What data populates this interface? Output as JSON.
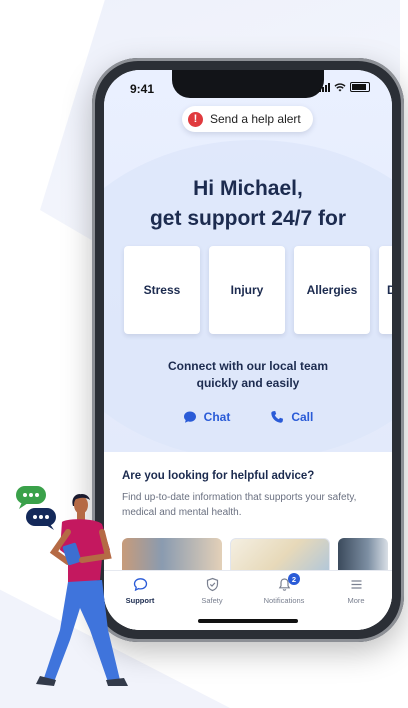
{
  "status_bar": {
    "time": "9:41"
  },
  "help_alert": {
    "icon": "exclamation-icon",
    "label": "Send a help alert"
  },
  "greeting": {
    "line1": "Hi Michael,",
    "line2": "get support 24/7 for"
  },
  "support_cards": [
    {
      "label": "Stress"
    },
    {
      "label": "Injury"
    },
    {
      "label": "Allergies"
    },
    {
      "label": "D"
    }
  ],
  "connect": {
    "line1": "Connect with our local team",
    "line2": "quickly and easily"
  },
  "actions": {
    "chat": {
      "label": "Chat",
      "icon": "chat-bubble-icon"
    },
    "call": {
      "label": "Call",
      "icon": "phone-icon"
    }
  },
  "advice": {
    "title": "Are you looking for helpful advice?",
    "description": "Find up-to-date information that supports your safety, medical and mental health."
  },
  "tabbar": [
    {
      "label": "Support",
      "icon": "chat-bubble-icon",
      "active": true
    },
    {
      "label": "Safety",
      "icon": "shield-icon",
      "active": false
    },
    {
      "label": "Notifications",
      "icon": "bell-icon",
      "active": false,
      "badge": "2"
    },
    {
      "label": "More",
      "icon": "menu-icon",
      "active": false
    }
  ],
  "colors": {
    "accent": "#2a5bd7",
    "heading": "#1c2b4f",
    "alert": "#e03a3e"
  }
}
